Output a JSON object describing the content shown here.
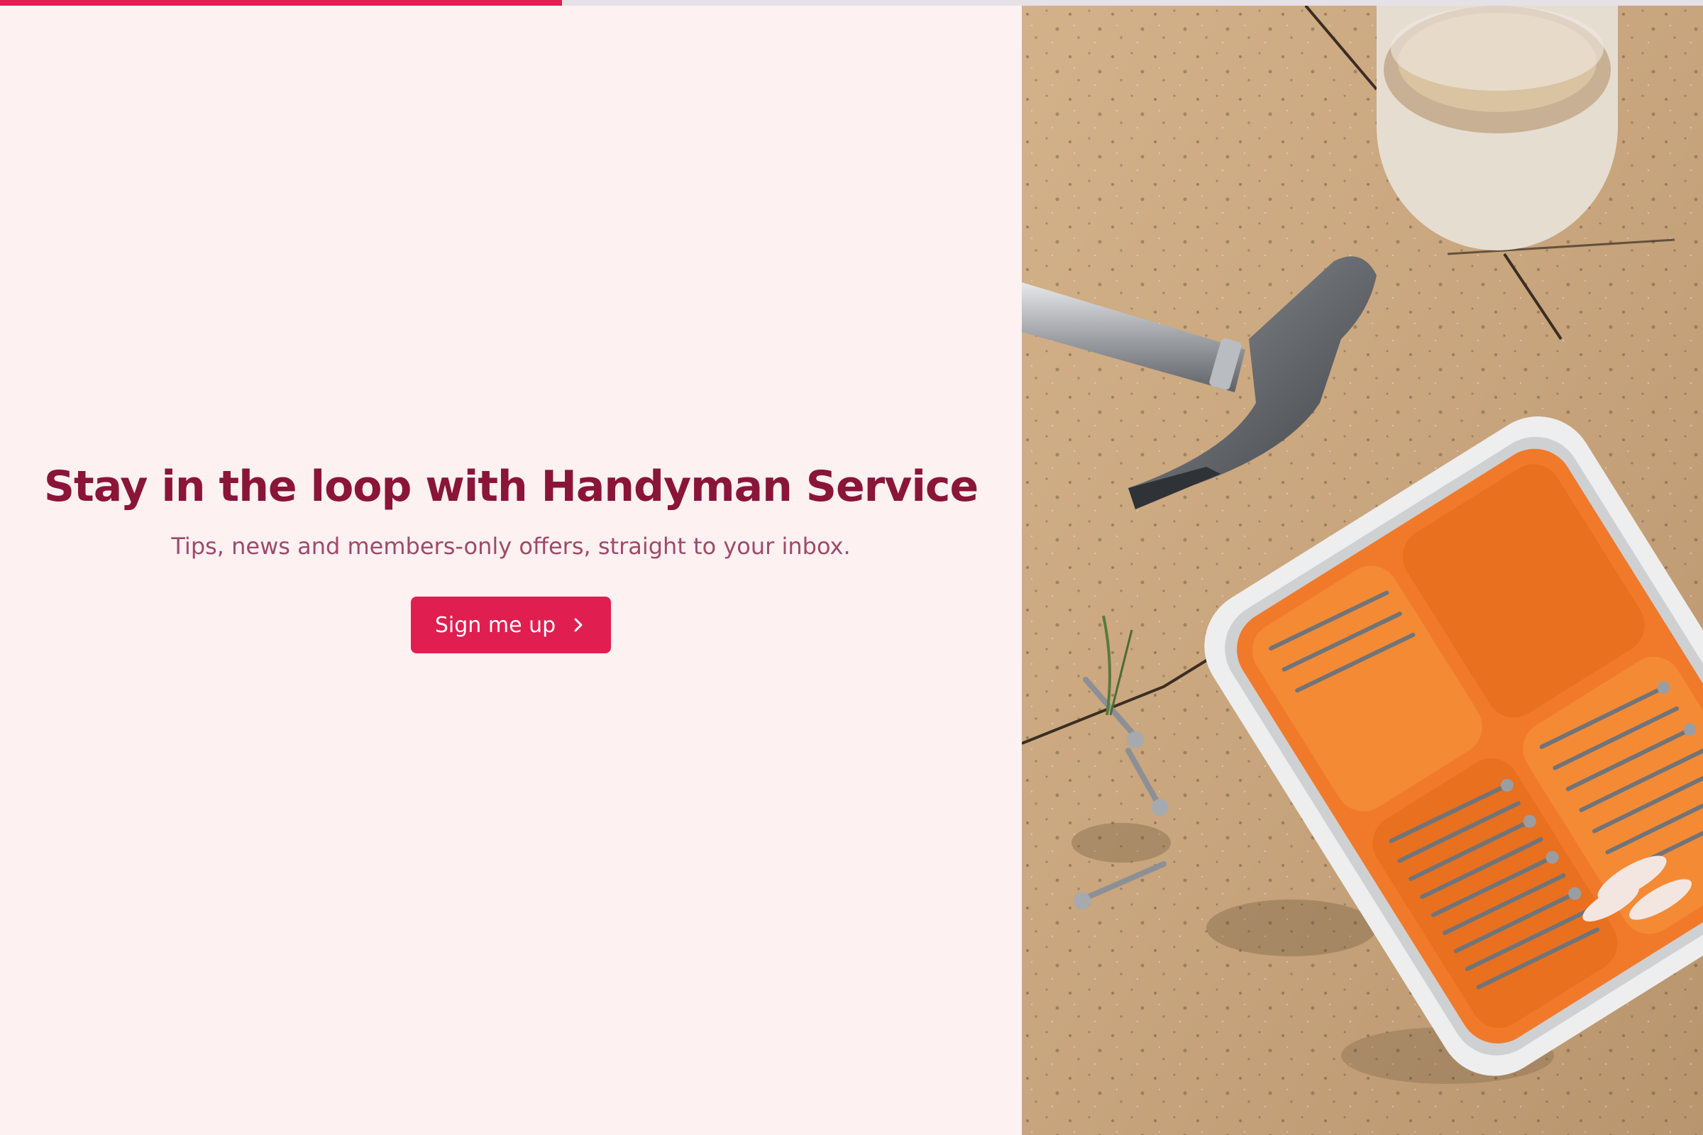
{
  "progress": {
    "value": 0.33,
    "color": "#e01e50"
  },
  "hero": {
    "title": "Stay in the loop with Handyman Service",
    "subtitle": "Tips, news and members-only offers, straight to your inbox.",
    "cta_label": "Sign me up",
    "cta_icon": "chevron-right-icon"
  },
  "colors": {
    "background": "#fdf1f2",
    "title": "#8a1538",
    "subtitle": "#9e4a6a",
    "accent": "#e01e50"
  },
  "image": {
    "subject": "hammer, tape roll and orange organizer tray of screws on stone tiles"
  }
}
